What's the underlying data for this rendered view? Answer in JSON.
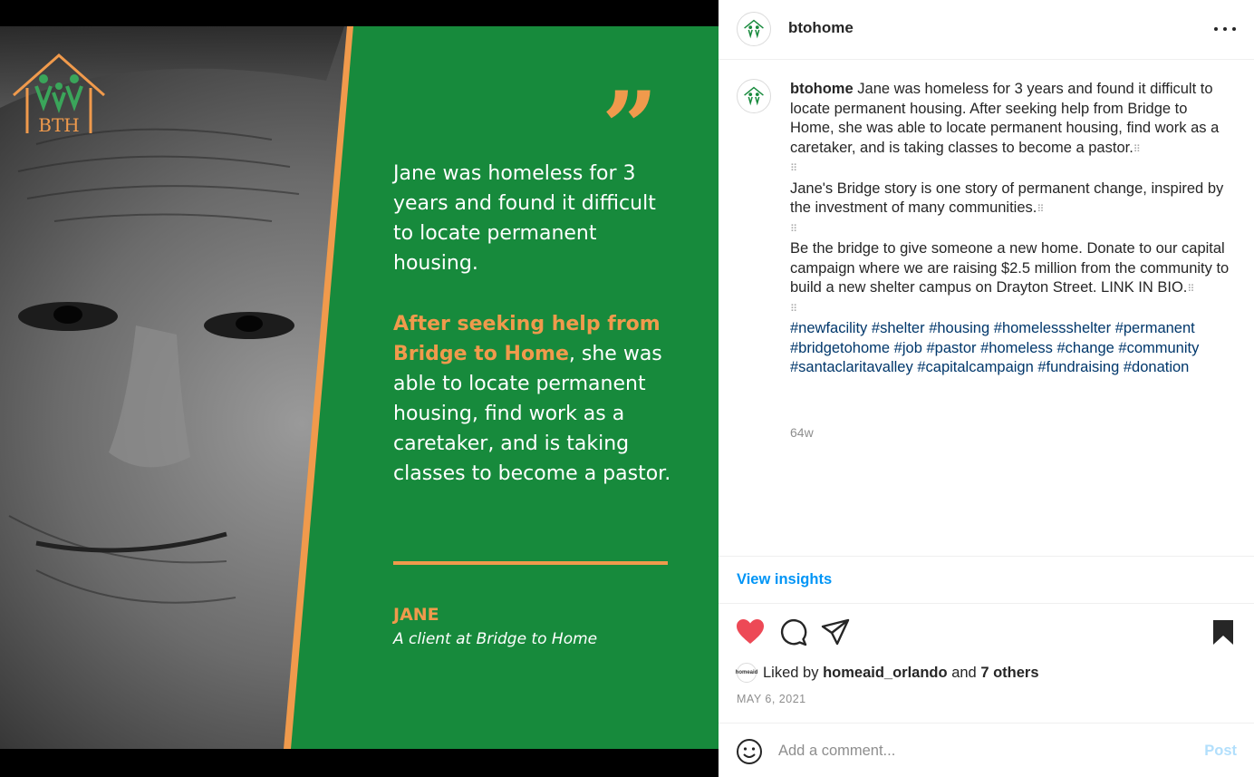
{
  "post": {
    "username": "btohome",
    "quote_mark": "”",
    "quote_para1": "Jane was homeless for 3 years and found it difficult to locate permanent housing.",
    "quote_para2_highlight": "After seeking help from Bridge to Home",
    "quote_para2_rest": ", she was able to locate permanent housing, find work as a caretaker, and is taking classes to become a pastor.",
    "client_name": "JANE",
    "client_role": "A client at Bridge to Home",
    "logo_text": "BTH"
  },
  "caption": {
    "username": "btohome",
    "para1": "Jane was homeless for 3 years and found it difficult to locate permanent housing. After seeking help from Bridge to Home, she was able to locate permanent housing, find work as a caretaker, and is taking classes to become a pastor.",
    "para2": "Jane's Bridge story is one story of permanent change, inspired by the investment of many communities.",
    "para3": "Be the bridge to give someone a new home. Donate to our capital campaign where we are raising $2.5 million from the community to build a new shelter campus on Drayton Street. LINK IN BIO.",
    "separator": "⠿",
    "hashtags": [
      "#newfacility",
      "#shelter",
      "#housing",
      "#homelessshelter",
      "#permanent",
      "#bridgetohome",
      "#job",
      "#pastor",
      "#homeless",
      "#change",
      "#community",
      "#santaclaritavalley",
      "#capitalcampaign",
      "#fundraising",
      "#donation"
    ],
    "time_ago": "64w"
  },
  "insights": {
    "label": "View insights"
  },
  "likes": {
    "prefix": "Liked by",
    "first_user": "homeaid_orlando",
    "joiner": "and",
    "others": "7 others",
    "mini_avatar_text": "homeaid"
  },
  "date": "MAY 6, 2021",
  "comment": {
    "placeholder": "Add a comment...",
    "post_label": "Post"
  },
  "colors": {
    "green": "#178a3c",
    "orange": "#f09a4c",
    "like_red": "#ed4956",
    "link_blue": "#0095f6",
    "hashtag_blue": "#00376b"
  },
  "icons": [
    "heart-icon",
    "comment-icon",
    "share-icon",
    "bookmark-icon",
    "more-icon",
    "emoji-icon"
  ]
}
